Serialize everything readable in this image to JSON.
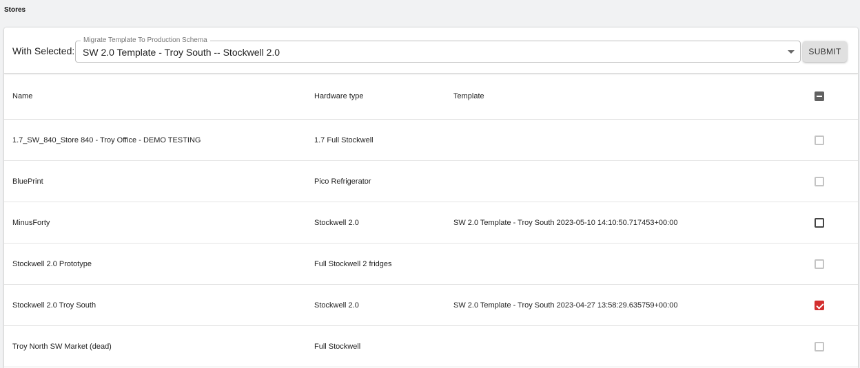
{
  "page": {
    "title": "Stores"
  },
  "toolbar": {
    "with_selected_label": "With Selected:",
    "select_legend": "Migrate Template To Production Schema",
    "select_value": "SW 2.0 Template - Troy South -- Stockwell 2.0",
    "submit_label": "SUBMIT"
  },
  "table": {
    "columns": [
      "Name",
      "Hardware type",
      "Template"
    ],
    "select_all_state": "indeterminate",
    "rows": [
      {
        "name": "1.7_SW_840_Store 840 - Troy Office - DEMO TESTING",
        "hardware_type": "1.7 Full Stockwell",
        "template": "",
        "checked": false
      },
      {
        "name": "BluePrint",
        "hardware_type": "Pico Refrigerator",
        "template": "",
        "checked": false
      },
      {
        "name": "MinusForty",
        "hardware_type": "Stockwell 2.0",
        "template": "SW 2.0 Template - Troy South 2023-05-10 14:10:50.717453+00:00",
        "checked": false
      },
      {
        "name": "Stockwell 2.0 Prototype",
        "hardware_type": "Full Stockwell 2 fridges",
        "template": "",
        "checked": false
      },
      {
        "name": "Stockwell 2.0 Troy South",
        "hardware_type": "Stockwell 2.0",
        "template": "SW 2.0 Template - Troy South 2023-04-27 13:58:29.635759+00:00",
        "checked": true
      },
      {
        "name": "Troy North SW Market (dead)",
        "hardware_type": "Full Stockwell",
        "template": "",
        "checked": false
      }
    ]
  },
  "colors": {
    "checked": "#d32f2f",
    "indeterminate": "#616161",
    "background": "#f1f2f3"
  }
}
